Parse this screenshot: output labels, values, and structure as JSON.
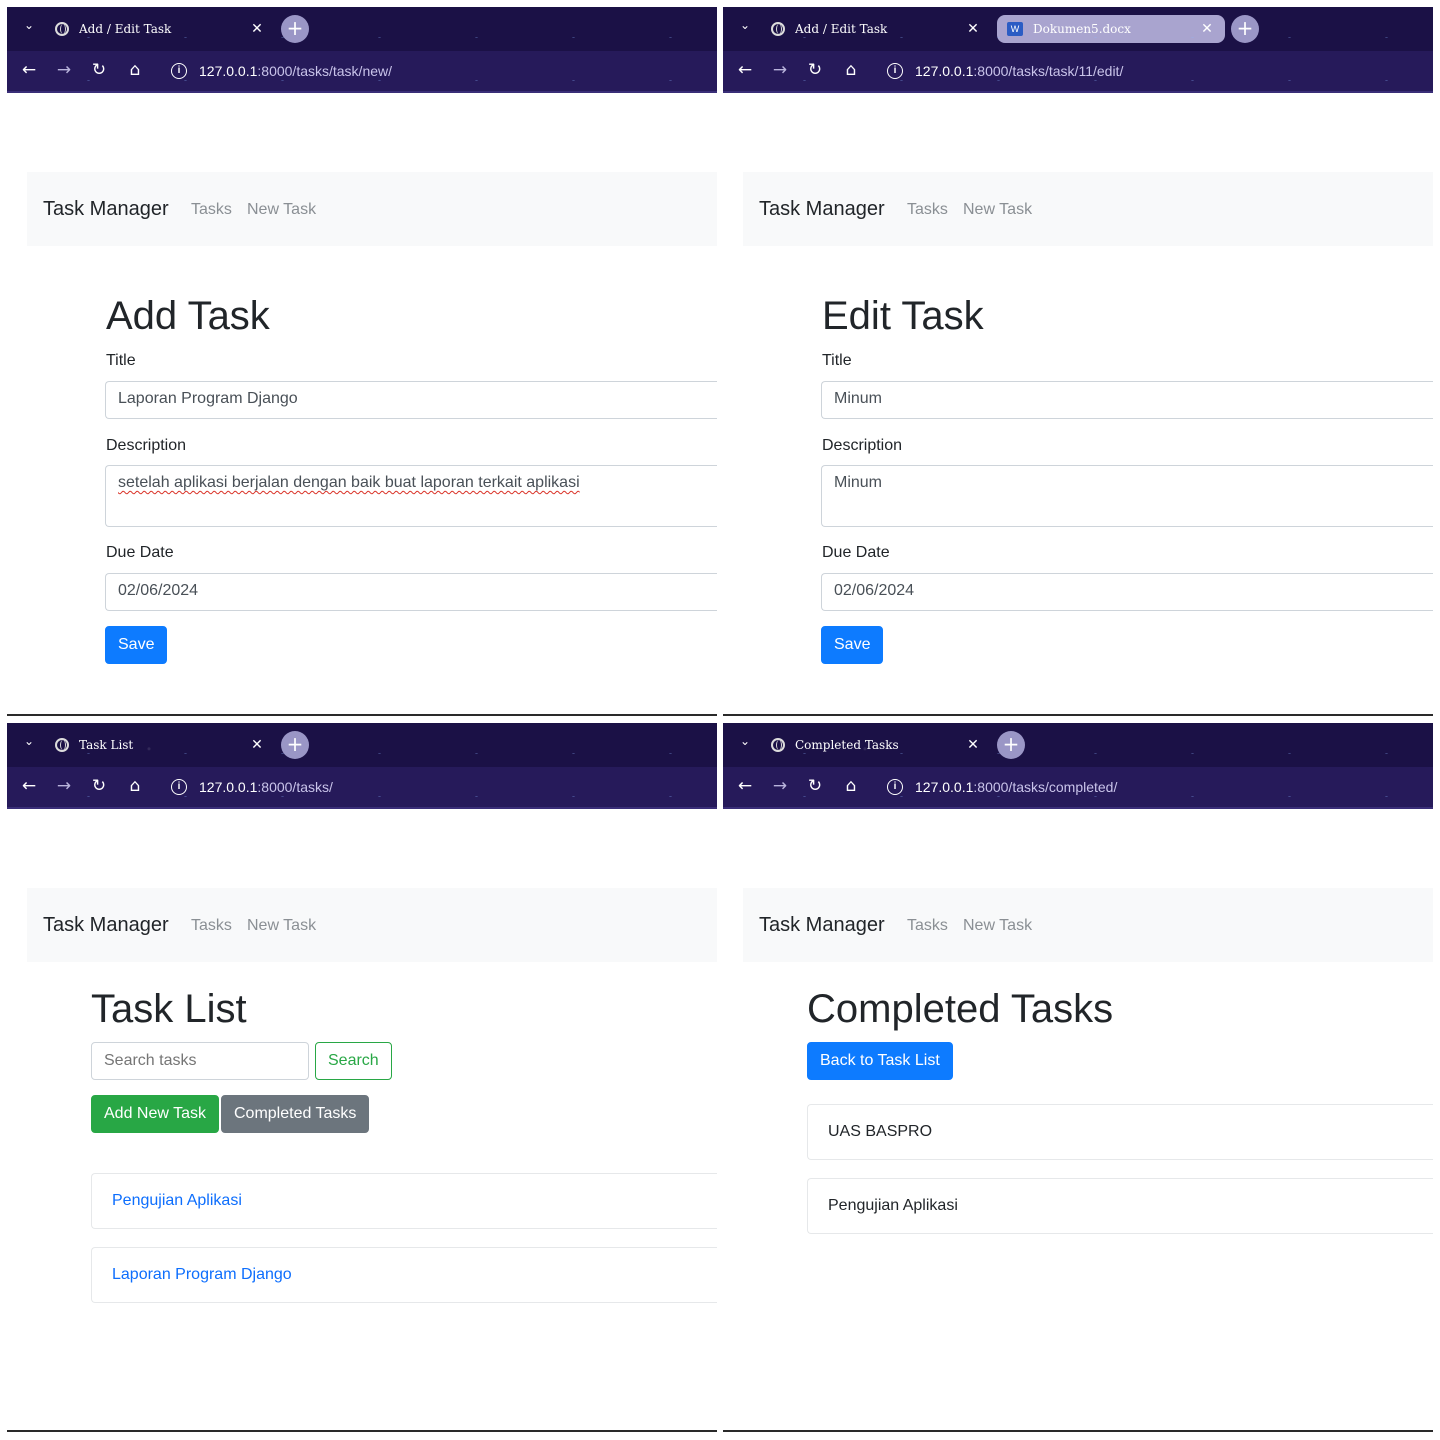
{
  "panels": [
    {
      "chrome": {
        "tabs": [
          {
            "title": "Add / Edit Task",
            "icon": "globe-icon",
            "active": true
          }
        ],
        "url_host": "127.0.0.1",
        "url_path": ":8000/tasks/task/new/"
      },
      "navbar": {
        "brand": "Task Manager",
        "links": [
          "Tasks",
          "New Task"
        ]
      },
      "heading": "Add Task",
      "form": {
        "title_label": "Title",
        "title_value": "Laporan Program Django",
        "description_label": "Description",
        "description_value": "setelah aplikasi berjalan dengan baik buat laporan terkait aplikasi",
        "due_date_label": "Due Date",
        "due_date_value": "02/06/2024",
        "save_label": "Save"
      }
    },
    {
      "chrome": {
        "tabs": [
          {
            "title": "Add / Edit Task",
            "icon": "globe-icon",
            "active": true
          },
          {
            "title": "Dokumen5.docx",
            "icon": "word-document-icon",
            "active": false
          }
        ],
        "url_host": "127.0.0.1",
        "url_path": ":8000/tasks/task/11/edit/"
      },
      "navbar": {
        "brand": "Task Manager",
        "links": [
          "Tasks",
          "New Task"
        ]
      },
      "heading": "Edit Task",
      "form": {
        "title_label": "Title",
        "title_value": "Minum",
        "description_label": "Description",
        "description_value": "Minum",
        "due_date_label": "Due Date",
        "due_date_value": "02/06/2024",
        "save_label": "Save"
      }
    },
    {
      "chrome": {
        "tabs": [
          {
            "title": "Task List",
            "icon": "globe-icon",
            "active": true
          }
        ],
        "url_host": "127.0.0.1",
        "url_path": ":8000/tasks/"
      },
      "navbar": {
        "brand": "Task Manager",
        "links": [
          "Tasks",
          "New Task"
        ]
      },
      "heading": "Task List",
      "search": {
        "placeholder": "Search tasks",
        "button_label": "Search"
      },
      "buttons": {
        "add_new": "Add New Task",
        "completed": "Completed Tasks"
      },
      "tasks": [
        "Pengujian Aplikasi",
        "Laporan Program Django"
      ]
    },
    {
      "chrome": {
        "tabs": [
          {
            "title": "Completed Tasks",
            "icon": "globe-icon",
            "active": true
          }
        ],
        "url_host": "127.0.0.1",
        "url_path": ":8000/tasks/completed/"
      },
      "navbar": {
        "brand": "Task Manager",
        "links": [
          "Tasks",
          "New Task"
        ]
      },
      "heading": "Completed Tasks",
      "buttons": {
        "back": "Back to Task List"
      },
      "completed_tasks": [
        "UAS BASPRO",
        "Pengujian Aplikasi"
      ]
    }
  ],
  "colors": {
    "browser_bg": "#1b1146",
    "primary": "#0d7bff",
    "success": "#28a745",
    "secondary": "#6c757d",
    "navbar_bg": "#f8f9fa",
    "link": "#0d6efd"
  }
}
